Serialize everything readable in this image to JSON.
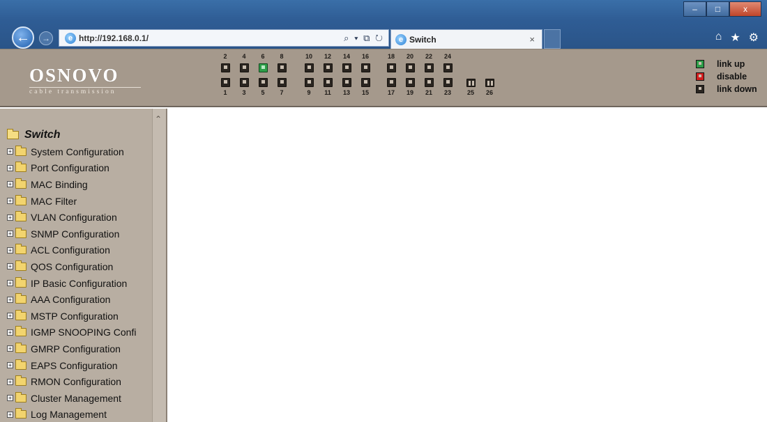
{
  "browser": {
    "url": "http://192.168.0.1/",
    "tab_title": "Switch",
    "tab_close": "×",
    "window_buttons": [
      "–",
      "□",
      "x"
    ],
    "toolbar_icons": [
      "home-icon",
      "star-icon",
      "gear-icon"
    ],
    "addr_tools": "⌕ ▾ ⧉ ↻"
  },
  "header": {
    "logo_main": "OSNOVO",
    "logo_sub": "cable transmission",
    "ports_top": [
      {
        "num": "2",
        "status": "down"
      },
      {
        "num": "4",
        "status": "down"
      },
      {
        "num": "6",
        "status": "up"
      },
      {
        "num": "8",
        "status": "down"
      },
      {
        "num": "10",
        "status": "down"
      },
      {
        "num": "12",
        "status": "down"
      },
      {
        "num": "14",
        "status": "down"
      },
      {
        "num": "16",
        "status": "down"
      },
      {
        "num": "18",
        "status": "down"
      },
      {
        "num": "20",
        "status": "down"
      },
      {
        "num": "22",
        "status": "down"
      },
      {
        "num": "24",
        "status": "down"
      }
    ],
    "ports_bottom": [
      {
        "num": "1",
        "status": "down"
      },
      {
        "num": "3",
        "status": "down"
      },
      {
        "num": "5",
        "status": "down"
      },
      {
        "num": "7",
        "status": "down"
      },
      {
        "num": "9",
        "status": "down"
      },
      {
        "num": "11",
        "status": "down"
      },
      {
        "num": "13",
        "status": "down"
      },
      {
        "num": "15",
        "status": "down"
      },
      {
        "num": "17",
        "status": "down"
      },
      {
        "num": "19",
        "status": "down"
      },
      {
        "num": "21",
        "status": "down"
      },
      {
        "num": "23",
        "status": "down"
      }
    ],
    "ports_fiber": [
      {
        "num": "25",
        "status": "down"
      },
      {
        "num": "26",
        "status": "down"
      }
    ],
    "legend": [
      {
        "label": "link up",
        "color": "#2d9d48"
      },
      {
        "label": "disable",
        "color": "#d11e1e"
      },
      {
        "label": "link down",
        "color": "#2a2520"
      }
    ]
  },
  "sidebar": {
    "root_label": "Switch",
    "items": [
      "System Configuration",
      "Port Configuration",
      "MAC Binding",
      "MAC Filter",
      "VLAN Configuration",
      "SNMP Configuration",
      "ACL Configuration",
      "QOS Configuration",
      "IP Basic Configuration",
      "AAA Configuration",
      "MSTP Configuration",
      "IGMP SNOOPING Confi",
      "GMRP Configuration",
      "EAPS Configuration",
      "RMON Configuration",
      "Cluster Management",
      "Log Management"
    ],
    "expand_symbol": "+"
  },
  "colors": {
    "header_bg": "#a5998c",
    "sidebar_bg": "#b8aea2",
    "port_up": "#2d9d48",
    "port_disabled": "#d11e1e",
    "port_down": "#2a2520"
  }
}
